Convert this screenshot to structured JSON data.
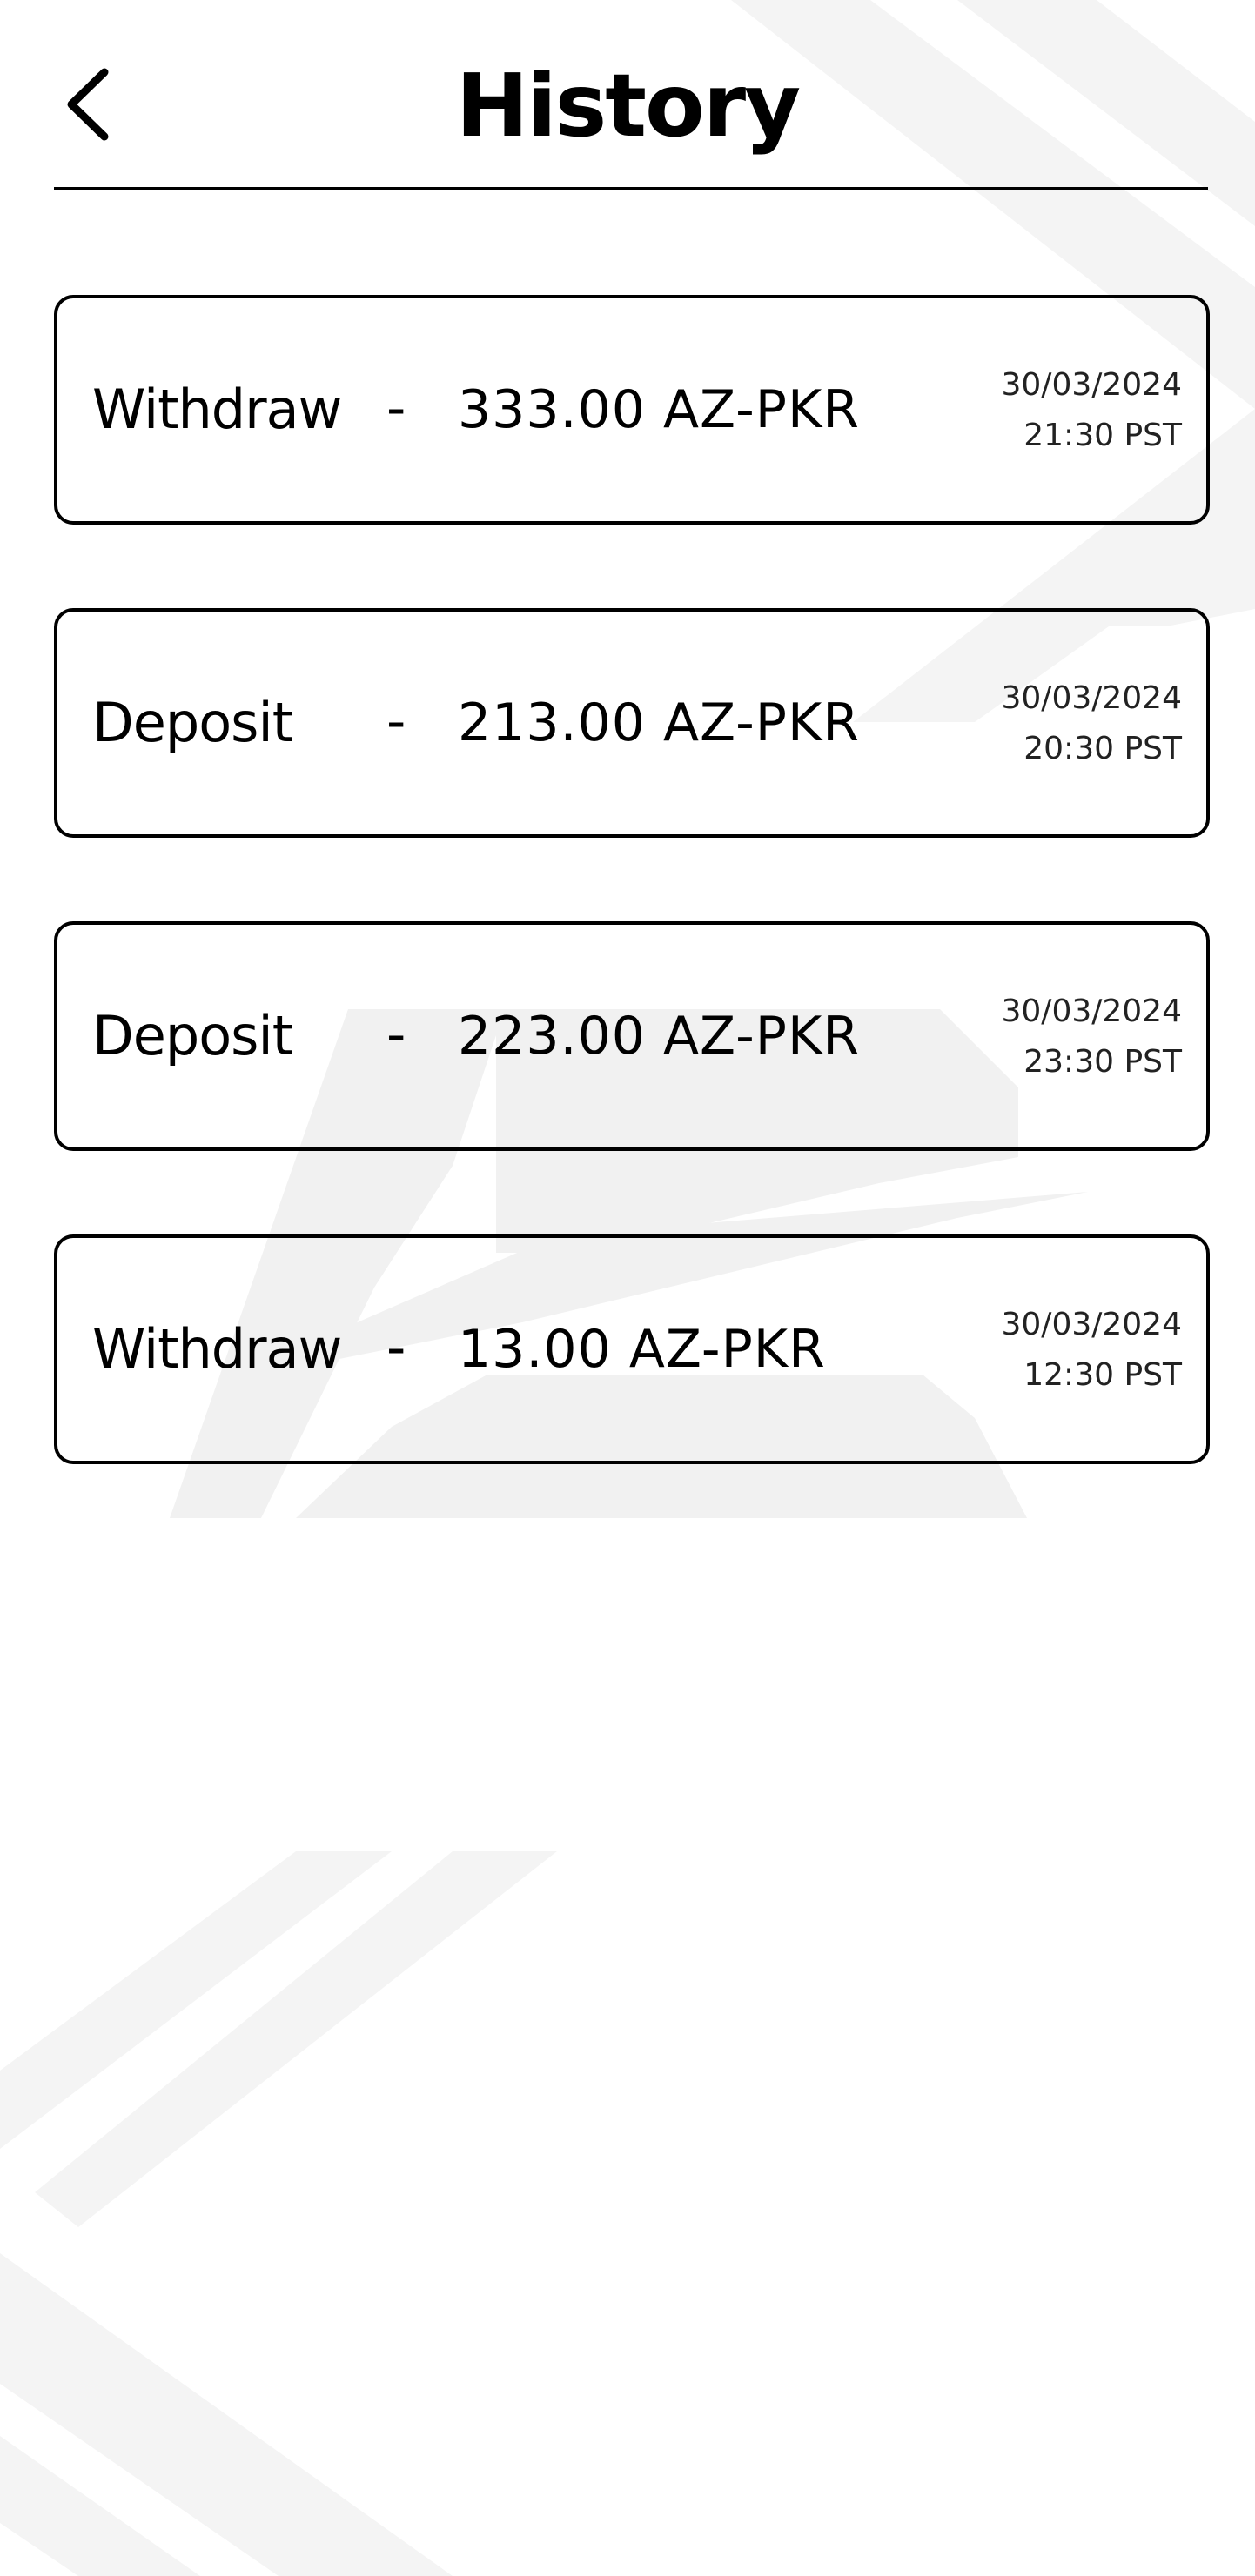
{
  "header": {
    "title": "History",
    "back_icon": "chevron-left-icon"
  },
  "history": [
    {
      "type": "Withdraw",
      "separator": "-",
      "amount": "333.00 AZ-PKR",
      "date": "30/03/2024",
      "time": "21:30 PST"
    },
    {
      "type": "Deposit",
      "separator": "-",
      "amount": "213.00 AZ-PKR",
      "date": "30/03/2024",
      "time": "20:30 PST"
    },
    {
      "type": "Deposit",
      "separator": "-",
      "amount": "223.00 AZ-PKR",
      "date": "30/03/2024",
      "time": "23:30 PST"
    },
    {
      "type": "Withdraw",
      "separator": "-",
      "amount": "13.00 AZ-PKR",
      "date": "30/03/2024",
      "time": "12:30 PST"
    }
  ],
  "colors": {
    "text": "#000000",
    "background": "#ffffff",
    "watermark": "#f3f3f3"
  }
}
